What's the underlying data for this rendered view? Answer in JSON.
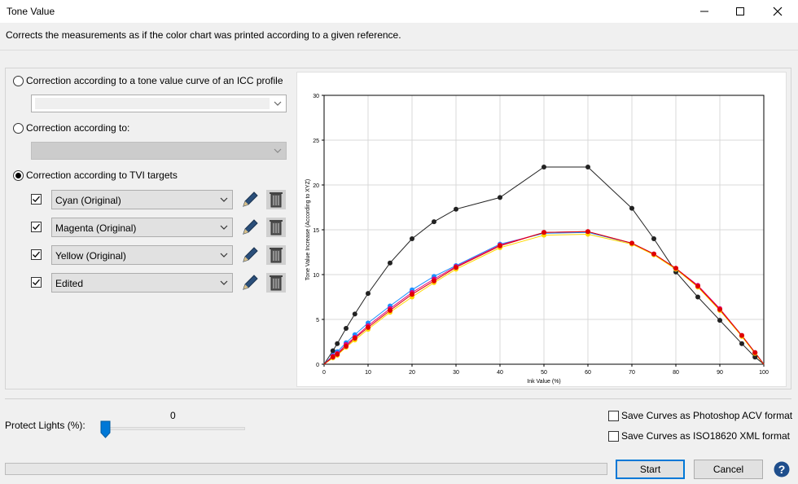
{
  "window": {
    "title": "Tone Value",
    "description": "Corrects the measurements as if the color chart was printed according to a given reference."
  },
  "options": {
    "icc_label": "Correction according to a tone value curve of an ICC profile",
    "according_label": "Correction according to:",
    "tvi_label": "Correction according to TVI targets",
    "selected": "tvi"
  },
  "tvi_targets": [
    {
      "label": "Cyan (Original)",
      "checked": true
    },
    {
      "label": "Magenta (Original)",
      "checked": true
    },
    {
      "label": "Yellow (Original)",
      "checked": true
    },
    {
      "label": "Edited",
      "checked": true
    }
  ],
  "icons": {
    "edit": "pencil-icon",
    "delete": "trash-icon",
    "help": "help-icon"
  },
  "protect_lights": {
    "label": "Protect Lights (%):",
    "value": "0"
  },
  "save_options": {
    "acv": "Save Curves as Photoshop ACV format",
    "xml": "Save Curves as ISO18620 XML format"
  },
  "buttons": {
    "start": "Start",
    "cancel": "Cancel"
  },
  "colors": {
    "accent": "#0078d7",
    "cyan": "#1e90ff",
    "magenta": "#e0007a",
    "yellow": "#ffd700",
    "red": "#e00000",
    "black": "#222222"
  },
  "chart_data": {
    "type": "line",
    "xlabel": "Ink Value (%)",
    "ylabel": "Tone Value Increase (According to XYZ)",
    "xlim": [
      0,
      100
    ],
    "ylim": [
      0,
      30
    ],
    "xticks": [
      0,
      10,
      20,
      30,
      40,
      50,
      60,
      70,
      80,
      90,
      100
    ],
    "yticks": [
      0,
      5,
      10,
      15,
      20,
      25,
      30
    ],
    "grid": true,
    "series": [
      {
        "color": "#222222",
        "x": [
          0,
          2,
          3,
          5,
          7,
          10,
          15,
          20,
          25,
          30,
          40,
          50,
          60,
          70,
          75,
          80,
          85,
          90,
          95,
          98,
          100
        ],
        "y": [
          0,
          1.5,
          2.3,
          4.0,
          5.6,
          7.9,
          11.3,
          14.0,
          15.9,
          17.3,
          18.6,
          22.0,
          22.0,
          17.4,
          14.0,
          10.3,
          7.5,
          4.9,
          2.3,
          0.8,
          0
        ]
      },
      {
        "color": "#1e90ff",
        "x": [
          0,
          2,
          3,
          5,
          7,
          10,
          15,
          20,
          25,
          30,
          40,
          50,
          60,
          70,
          75,
          80,
          85,
          90,
          95,
          98,
          100
        ],
        "y": [
          0,
          1.0,
          1.4,
          2.4,
          3.3,
          4.6,
          6.5,
          8.3,
          9.8,
          11.0,
          13.4,
          14.6,
          14.7,
          13.5,
          12.3,
          10.6,
          8.7,
          6.1,
          3.2,
          1.3,
          0
        ]
      },
      {
        "color": "#e0007a",
        "x": [
          0,
          2,
          3,
          5,
          7,
          10,
          15,
          20,
          25,
          30,
          40,
          50,
          60,
          70,
          75,
          80,
          85,
          90,
          95,
          98,
          100
        ],
        "y": [
          0,
          0.9,
          1.2,
          2.2,
          3.0,
          4.3,
          6.2,
          8.0,
          9.5,
          10.9,
          13.3,
          14.7,
          14.8,
          13.5,
          12.3,
          10.7,
          8.8,
          6.2,
          3.2,
          1.3,
          0
        ]
      },
      {
        "color": "#ffd700",
        "x": [
          0,
          2,
          3,
          5,
          7,
          10,
          15,
          20,
          25,
          30,
          40,
          50,
          60,
          70,
          75,
          80,
          85,
          90,
          95,
          98,
          100
        ],
        "y": [
          0,
          0.7,
          1.0,
          1.9,
          2.7,
          3.9,
          5.8,
          7.5,
          9.1,
          10.6,
          13.0,
          14.4,
          14.5,
          13.4,
          12.2,
          10.6,
          8.6,
          6.0,
          3.1,
          1.2,
          0
        ]
      },
      {
        "color": "#e00000",
        "x": [
          0,
          2,
          3,
          5,
          7,
          10,
          15,
          20,
          25,
          30,
          40,
          50,
          60,
          70,
          75,
          80,
          85,
          90,
          95,
          98,
          100
        ],
        "y": [
          0,
          0.8,
          1.1,
          2.0,
          2.9,
          4.1,
          6.0,
          7.8,
          9.3,
          10.8,
          13.2,
          14.7,
          14.8,
          13.5,
          12.3,
          10.7,
          8.7,
          6.1,
          3.2,
          1.3,
          0
        ]
      }
    ]
  }
}
